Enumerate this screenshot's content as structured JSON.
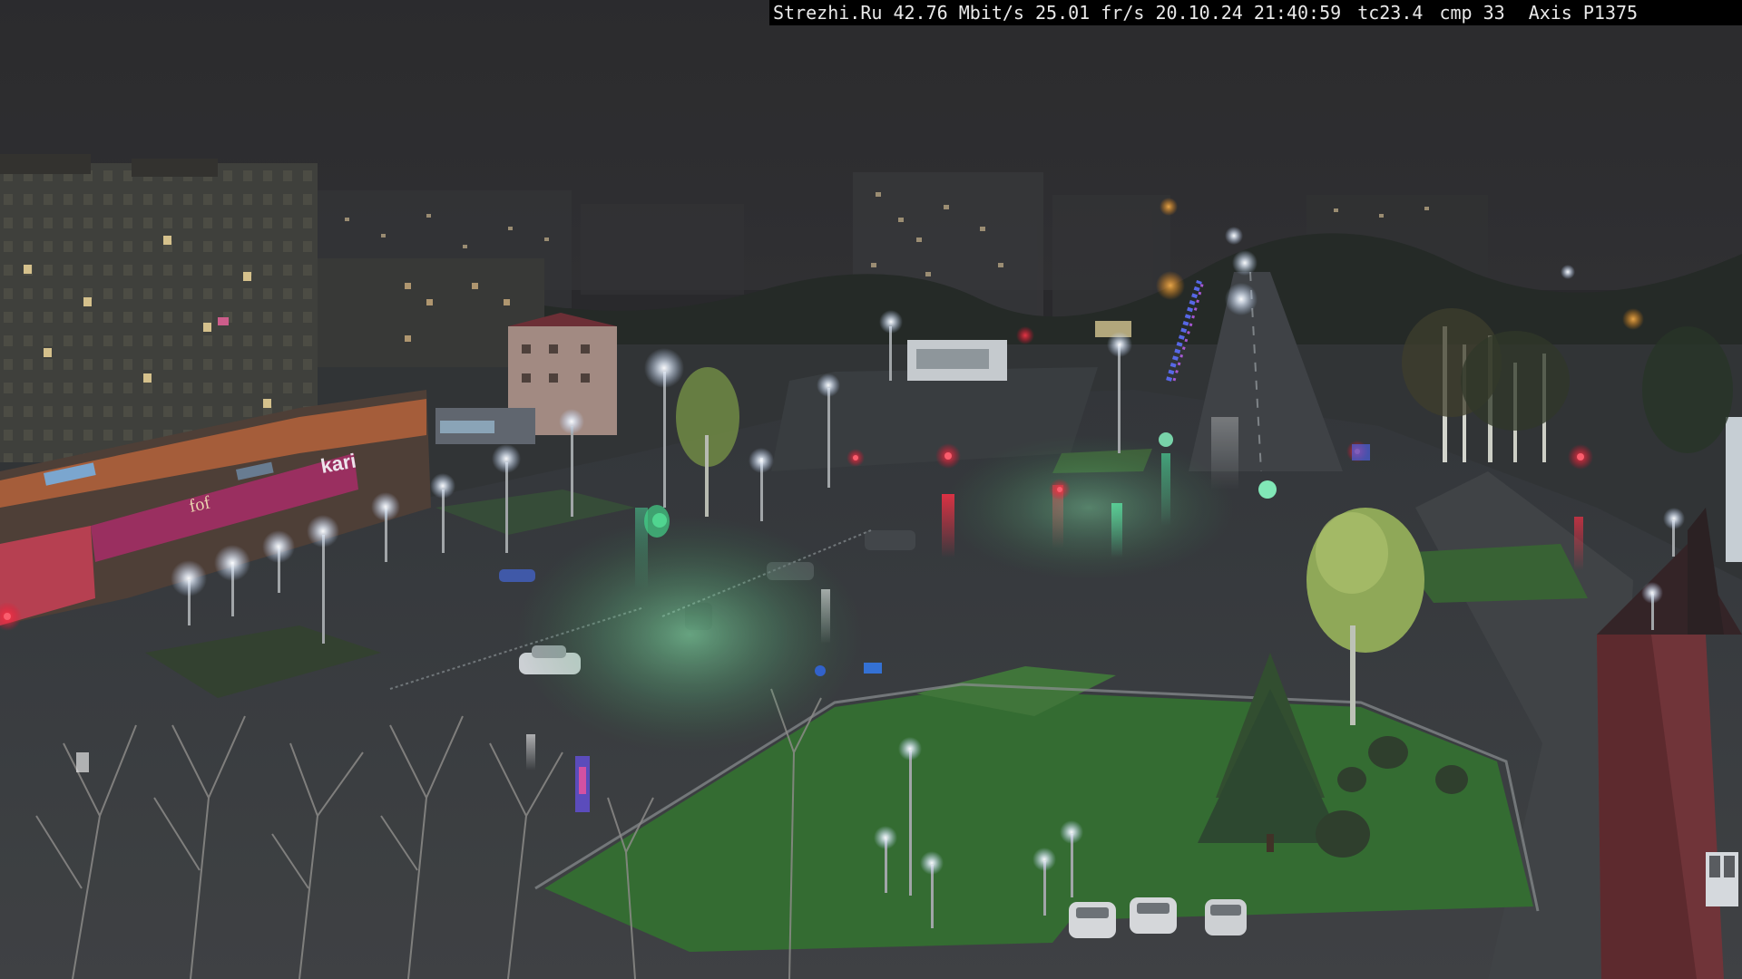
{
  "overlay": {
    "site": "Strezhi.Ru",
    "bitrate": "42.76 Mbit/s",
    "framerate": "25.01 fr/s",
    "datetime": "20.10.24 21:40:59",
    "tc": "tc23.4",
    "cmp": "cmp 33",
    "camera": "Axis P1375"
  },
  "colors": {
    "sky": "#262628",
    "asphalt_wet": "#2f3233",
    "grass_lit": "#2f6a2c",
    "traffic_red": "#ff1f3a",
    "traffic_green": "#2cffa0",
    "lamp_white": "#f4f8ff",
    "sign_magenta": "#9a2a5c"
  }
}
